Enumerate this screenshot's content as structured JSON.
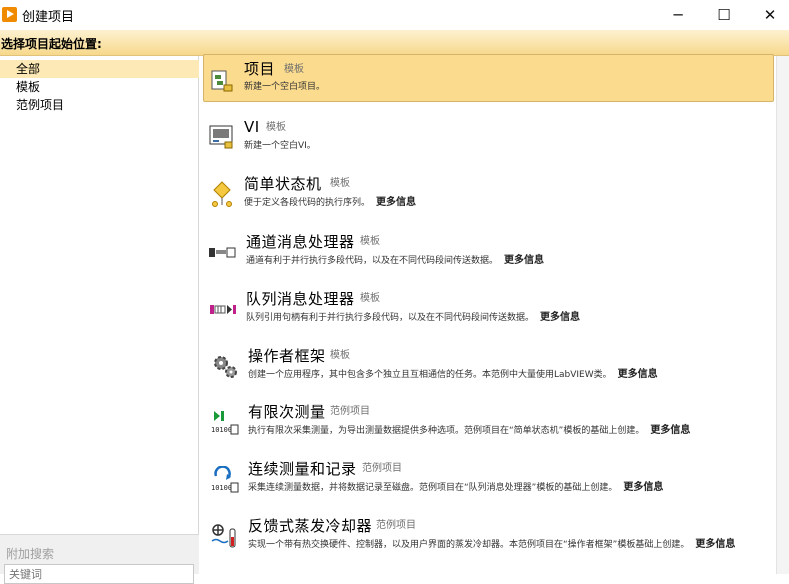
{
  "window": {
    "title": "创建项目",
    "minimize": "─",
    "maximize": "☐",
    "close": "✕"
  },
  "header": {
    "label": "选择项目起始位置:"
  },
  "categories": [
    {
      "label": "全部",
      "selected": true
    },
    {
      "label": "模板",
      "selected": false
    },
    {
      "label": "范例项目",
      "selected": false
    }
  ],
  "search": {
    "label": "附加搜索",
    "placeholder": "关键词"
  },
  "items": [
    {
      "title": "项目",
      "tag": "模板",
      "desc": "新建一个空白项目。",
      "more": "",
      "icon": "project-icon",
      "selected": true
    },
    {
      "title": "VI",
      "tag": "模板",
      "desc": "新建一个空白VI。",
      "more": "",
      "icon": "vi-icon",
      "selected": false
    },
    {
      "title": "简单状态机",
      "tag": "模板",
      "desc": "便于定义各段代码的执行序列。",
      "more": "更多信息",
      "icon": "state-machine-icon",
      "selected": false
    },
    {
      "title": "通道消息处理器",
      "tag": "模板",
      "desc": "通道有利于并行执行多段代码，以及在不同代码段间传送数据。",
      "more": "更多信息",
      "icon": "channel-icon",
      "selected": false
    },
    {
      "title": "队列消息处理器",
      "tag": "模板",
      "desc": "队列引用句柄有利于并行执行多段代码，以及在不同代码段间传送数据。",
      "more": "更多信息",
      "icon": "queue-icon",
      "selected": false
    },
    {
      "title": "操作者框架",
      "tag": "模板",
      "desc": "创建一个应用程序，其中包含多个独立且互相通信的任务。本范例中大量使用LabVIEW类。",
      "more": "更多信息",
      "icon": "gear-icon",
      "selected": false
    },
    {
      "title": "有限次测量",
      "tag": "范例项目",
      "desc": "执行有限次采集测量，为导出测量数据提供多种选项。范例项目在“简单状态机”模板的基础上创建。",
      "more": "更多信息",
      "icon": "finite-measurement-icon",
      "selected": false
    },
    {
      "title": "连续测量和记录",
      "tag": "范例项目",
      "desc": "采集连续测量数据，并将数据记录至磁盘。范例项目在“队列消息处理器”模板的基础上创建。",
      "more": "更多信息",
      "icon": "continuous-measurement-icon",
      "selected": false
    },
    {
      "title": "反馈式蒸发冷却器",
      "tag": "范例项目",
      "desc": "实现一个带有热交换硬件、控制器，以及用户界面的蒸发冷却器。本范例项目在“操作者框架”模板基础上创建。",
      "more": "更多信息",
      "icon": "evaporative-cooler-icon",
      "selected": false
    }
  ],
  "colors": {
    "accent": "#fbdb8d",
    "header": "#f7d98c",
    "app_icon": "#f08a00"
  }
}
